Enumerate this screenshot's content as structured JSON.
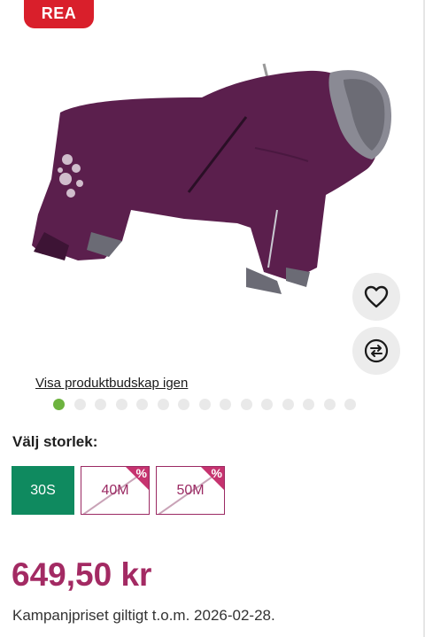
{
  "badge": {
    "label": "REA"
  },
  "gallery": {
    "reveal_link": "Visa produktbudskap igen",
    "dot_count": 15,
    "active_dot": 0
  },
  "actions": {
    "wishlist_icon": "heart-icon",
    "compare_icon": "compare-arrows-icon"
  },
  "size": {
    "heading": "Välj storlek:",
    "options": [
      {
        "label": "30S",
        "state": "selected",
        "badge": ""
      },
      {
        "label": "40M",
        "state": "unavailable",
        "badge": "%"
      },
      {
        "label": "50M",
        "state": "unavailable",
        "badge": "%"
      }
    ]
  },
  "price": {
    "value": "649,50 kr",
    "note": "Kampanjpriset giltigt t.o.m. 2026-02-28."
  },
  "colors": {
    "sale": "#d91f2b",
    "brand": "#a32a63",
    "selected": "#0f8a5f",
    "active_dot": "#6db33f"
  }
}
